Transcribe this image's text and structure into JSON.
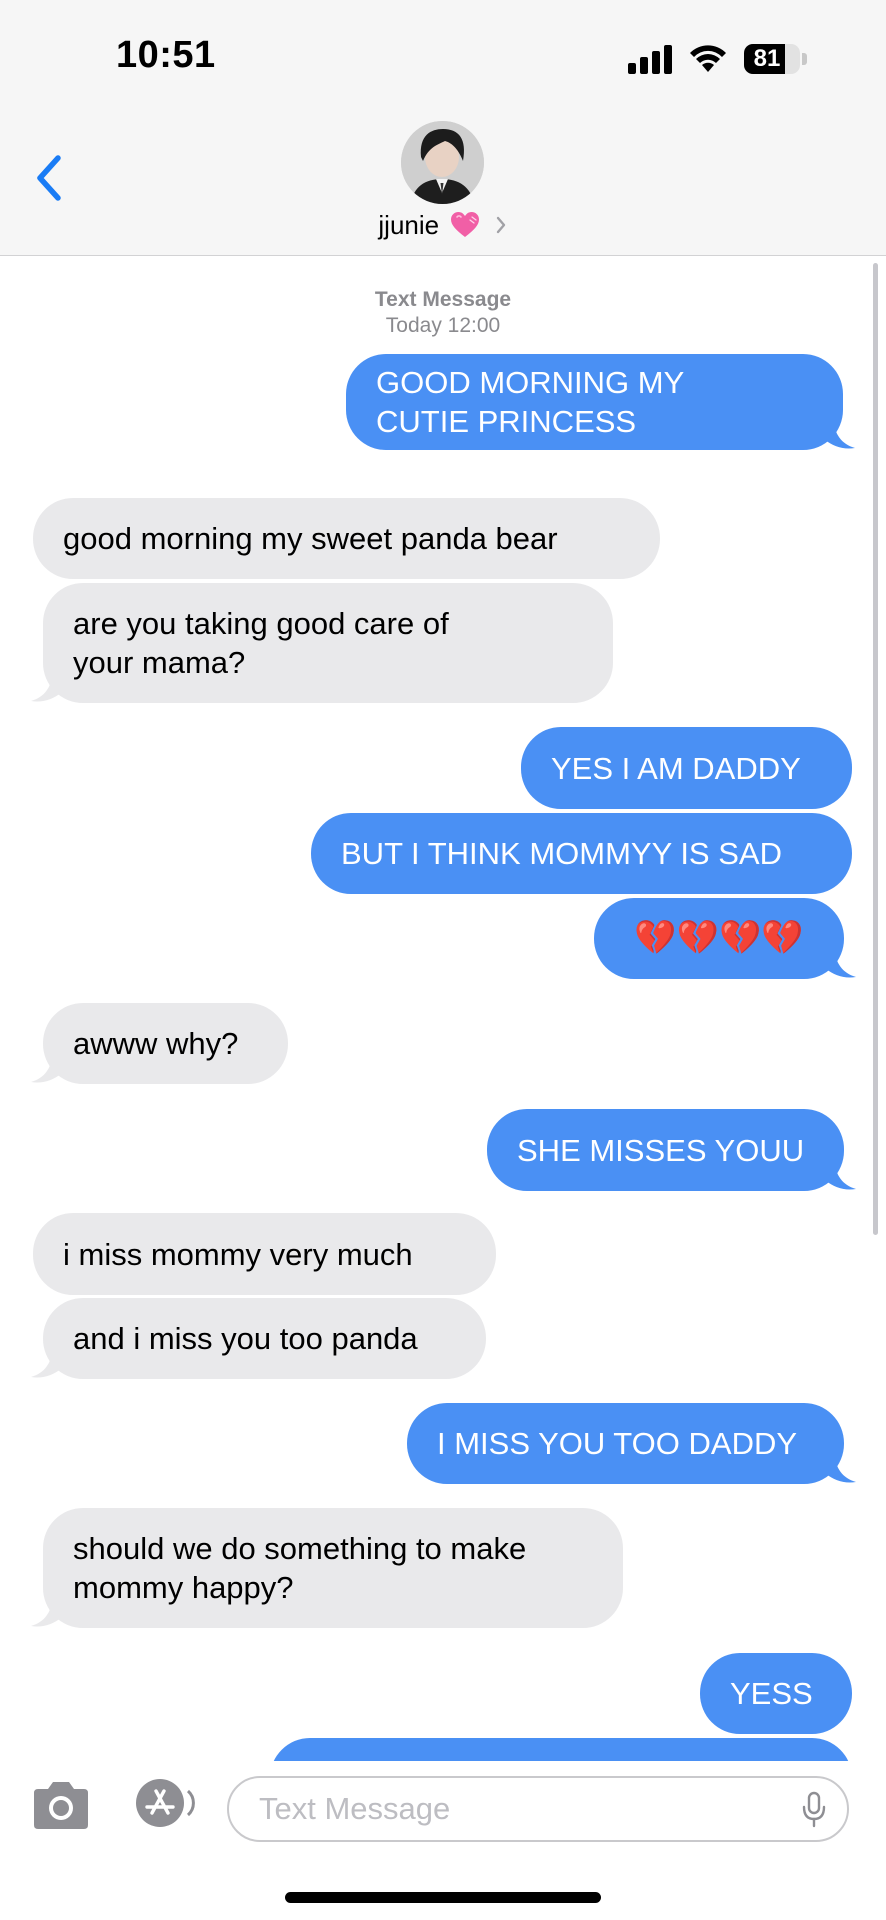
{
  "status_bar": {
    "time": "10:51",
    "battery_percent": 81,
    "battery_label": "81"
  },
  "header": {
    "back_icon": "chevron-left-icon",
    "contact_name": "jjunie",
    "contact_emoji": "pink-heart-icon",
    "details_icon": "chevron-right-icon"
  },
  "thread": {
    "service_label": "Text Message",
    "timestamp": "Today 12:00",
    "messages": [
      {
        "from": "me",
        "lines": [
          "GOOD MORNING MY",
          "CUTIE PRINCESS"
        ]
      },
      {
        "from": "them",
        "lines": [
          "good morning my sweet panda bear"
        ]
      },
      {
        "from": "them",
        "lines": [
          "are you taking good care of",
          "your mama?"
        ]
      },
      {
        "from": "me",
        "lines": [
          "YES I AM DADDY"
        ]
      },
      {
        "from": "me",
        "lines": [
          "BUT I THINK MOMMYY IS SAD"
        ]
      },
      {
        "from": "me",
        "lines": [
          "💔💔💔💔"
        ],
        "emoji": "broken-heart-icon",
        "emoji_count": 4
      },
      {
        "from": "them",
        "lines": [
          "awww why?"
        ]
      },
      {
        "from": "me",
        "lines": [
          "SHE MISSES YOUU"
        ]
      },
      {
        "from": "them",
        "lines": [
          "i miss mommy very much"
        ]
      },
      {
        "from": "them",
        "lines": [
          "and i miss you too panda"
        ]
      },
      {
        "from": "me",
        "lines": [
          "I MISS YOU TOO DADDY"
        ]
      },
      {
        "from": "them",
        "lines": [
          "should we do something to make",
          "mommy happy?"
        ]
      },
      {
        "from": "me",
        "lines": [
          "YESS"
        ]
      },
      {
        "from": "me",
        "lines": [
          ""
        ],
        "partially_visible": true
      }
    ]
  },
  "compose": {
    "placeholder": "Text Message",
    "value": "",
    "camera_icon": "camera-icon",
    "apps_icon": "app-store-icon",
    "mic_icon": "microphone-icon"
  },
  "colors": {
    "sent_bubble": "#4a90f4",
    "received_bubble": "#e9e9eb",
    "accent": "#1a7cf5",
    "header_bg": "#f6f6f6"
  }
}
